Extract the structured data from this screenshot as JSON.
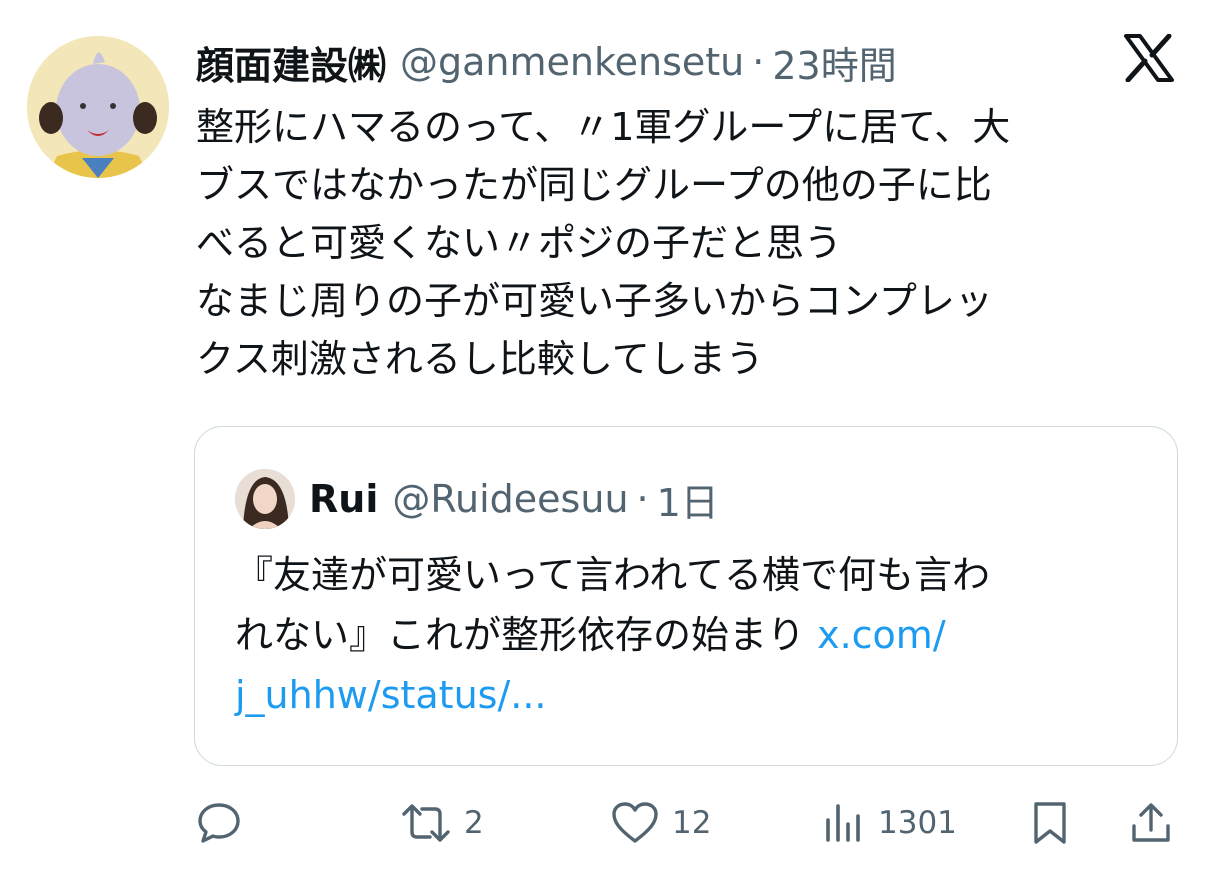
{
  "tweet": {
    "display_name": "顔面建設㈱",
    "handle": "@ganmenkensetu",
    "separator": "·",
    "time": "23時間",
    "text_lines": [
      "整形にハマるのって、〃1軍グループに居て、大",
      "ブスではなかったが同じグループの他の子に比",
      "べると可愛くない〃ポジの子だと思う",
      "なまじ周りの子が可愛い子多いからコンプレッ",
      "クス刺激されるし比較してしまう"
    ]
  },
  "quoted_tweet": {
    "display_name": "Rui",
    "handle": "@Ruideesuu",
    "separator": "·",
    "time": "1日",
    "text_line1": "『友達が可愛いって言われてる横で何も言わ",
    "text_line2": "れない』これが整形依存の始まり ",
    "link_part1": "x.com/",
    "link_part2": "j_uhhw/status/..."
  },
  "actions": {
    "reply_count": "",
    "retweet_count": "2",
    "like_count": "12",
    "views_count": "1301"
  },
  "icons": {
    "logo": "x-logo-icon",
    "reply": "reply-icon",
    "retweet": "retweet-icon",
    "like": "heart-icon",
    "views": "views-icon",
    "bookmark": "bookmark-icon",
    "share": "share-icon"
  },
  "colors": {
    "text": "#0f1419",
    "secondary": "#536471",
    "link": "#1d9bf0",
    "border": "#cfd9de"
  }
}
